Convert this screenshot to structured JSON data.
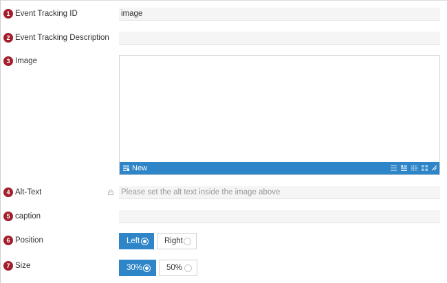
{
  "fields": [
    {
      "number": "1",
      "label": "Event Tracking ID",
      "value": "image"
    },
    {
      "number": "2",
      "label": "Event Tracking Description",
      "value": ""
    },
    {
      "number": "3",
      "label": "Image"
    },
    {
      "number": "4",
      "label": "Alt-Text",
      "placeholder": "Please set the alt text inside the image above"
    },
    {
      "number": "5",
      "label": "caption",
      "value": ""
    },
    {
      "number": "6",
      "label": "Position"
    },
    {
      "number": "7",
      "label": "Size"
    }
  ],
  "image_toolbar": {
    "new_label": "New",
    "icons": [
      "list-view-icon",
      "add-list-icon",
      "grid-add-icon",
      "grid-view-icon",
      "resize-handle-icon"
    ]
  },
  "position_options": [
    {
      "label": "Left",
      "selected": true
    },
    {
      "label": "Right",
      "selected": false
    }
  ],
  "size_options": [
    {
      "label": "30%",
      "selected": true
    },
    {
      "label": "50%",
      "selected": false
    }
  ],
  "colors": {
    "badge": "#a31f2c",
    "accent": "#2e86c9",
    "field_bg": "#f5f5f5"
  }
}
